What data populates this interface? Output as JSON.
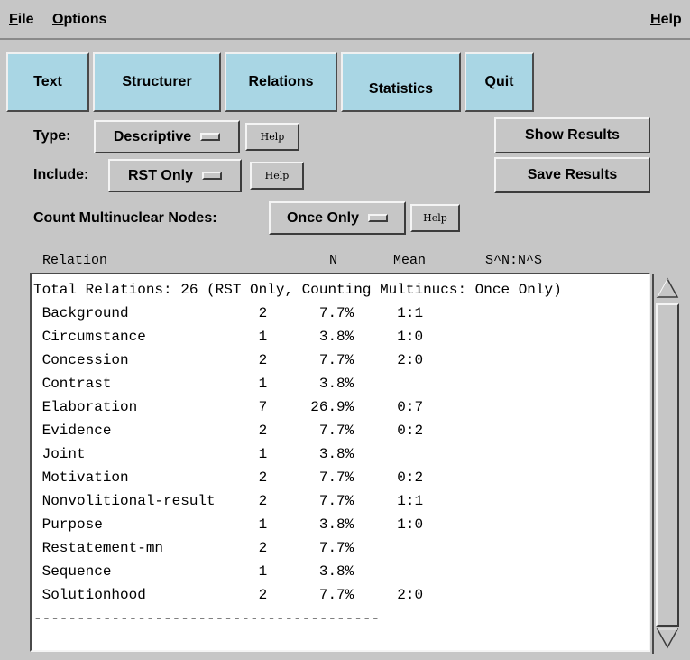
{
  "menu": {
    "file_u": "F",
    "file_rest": "ile",
    "options_u": "O",
    "options_rest": "ptions",
    "help_u": "H",
    "help_rest": "elp"
  },
  "tabs": [
    {
      "label": "Text"
    },
    {
      "label": "Structurer"
    },
    {
      "label": "Relations"
    },
    {
      "label": "Statistics"
    },
    {
      "label": "Quit"
    }
  ],
  "controls": {
    "type_label": "Type:",
    "type_value": "Descriptive",
    "include_label": "Include:",
    "include_value": "RST Only",
    "count_label": "Count Multinuclear Nodes:",
    "count_value": "Once Only",
    "help_label": "Help",
    "show_results": "Show Results",
    "save_results": "Save Results"
  },
  "table": {
    "headers": {
      "relation": "Relation",
      "n": "N",
      "mean": "Mean",
      "ratio": "S^N:N^S"
    },
    "summary": "Total Relations: 26 (RST Only, Counting Multinucs: Once Only)",
    "rows": [
      {
        "relation": "Background",
        "n": "2",
        "mean": "7.7%",
        "ratio": "1:1"
      },
      {
        "relation": "Circumstance",
        "n": "1",
        "mean": "3.8%",
        "ratio": "1:0"
      },
      {
        "relation": "Concession",
        "n": "2",
        "mean": "7.7%",
        "ratio": "2:0"
      },
      {
        "relation": "Contrast",
        "n": "1",
        "mean": "3.8%",
        "ratio": ""
      },
      {
        "relation": "Elaboration",
        "n": "7",
        "mean": "26.9%",
        "ratio": "0:7"
      },
      {
        "relation": "Evidence",
        "n": "2",
        "mean": "7.7%",
        "ratio": "0:2"
      },
      {
        "relation": "Joint",
        "n": "1",
        "mean": "3.8%",
        "ratio": ""
      },
      {
        "relation": "Motivation",
        "n": "2",
        "mean": "7.7%",
        "ratio": "0:2"
      },
      {
        "relation": "Nonvolitional-result",
        "n": "2",
        "mean": "7.7%",
        "ratio": "1:1"
      },
      {
        "relation": "Purpose",
        "n": "1",
        "mean": "3.8%",
        "ratio": "1:0"
      },
      {
        "relation": "Restatement-mn",
        "n": "2",
        "mean": "7.7%",
        "ratio": ""
      },
      {
        "relation": "Sequence",
        "n": "1",
        "mean": "3.8%",
        "ratio": ""
      },
      {
        "relation": "Solutionhood",
        "n": "2",
        "mean": "7.7%",
        "ratio": "2:0"
      }
    ],
    "separator": "----------------------------------------"
  }
}
